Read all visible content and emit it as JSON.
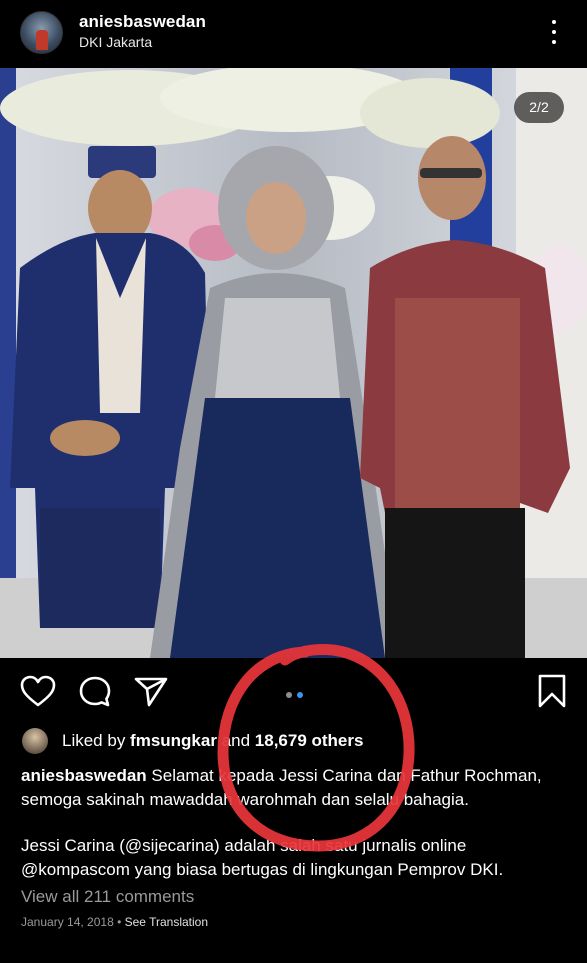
{
  "header": {
    "username": "aniesbaswedan",
    "location": "DKI Jakarta",
    "more_icon": "more-vertical-icon"
  },
  "photo": {
    "counter": "2/2",
    "carousel": {
      "count": 2,
      "active": 2
    }
  },
  "actions": {
    "like_icon": "heart-icon",
    "comment_icon": "comment-icon",
    "share_icon": "send-icon",
    "save_icon": "bookmark-icon"
  },
  "likes": {
    "prefix": "Liked by ",
    "user": "fmsungkar",
    "middle": " and ",
    "count": "18,679 others"
  },
  "caption": {
    "username": "aniesbaswedan",
    "text": " Selamat kepada Jessi Carina dan Fathur Rochman, semoga sakinah mawaddah warohmah dan selalu bahagia.",
    "text2": "Jessi Carina (@sijecarina) adalah salah satu jurnalis online @kompascom yang biasa bertugas di lingkungan Pemprov DKI."
  },
  "comments": {
    "view_all": "View all 211 comments"
  },
  "meta": {
    "date": "January 14, 2018",
    "separator": " • ",
    "see_translation": "See Translation"
  },
  "colors": {
    "background": "#000000",
    "dot_active": "#3897f0",
    "dot_inactive": "#8e8e8e",
    "annotation": "#e8353a",
    "muted_text": "#9a9a9a"
  }
}
